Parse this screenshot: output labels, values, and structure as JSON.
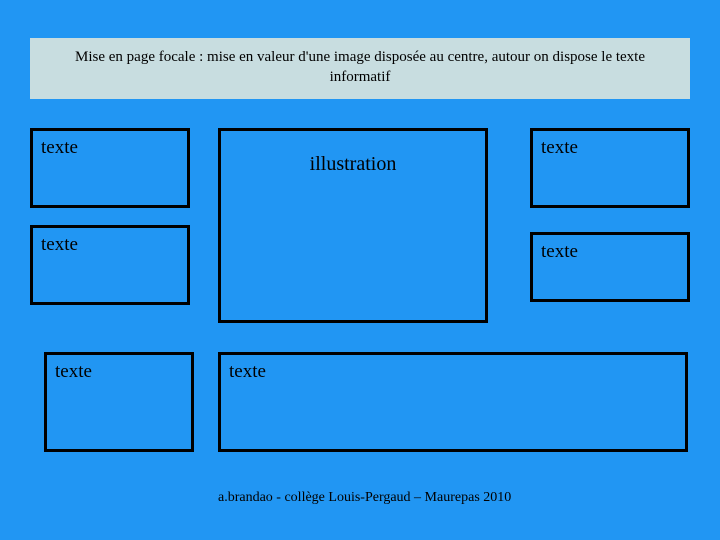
{
  "header": "Mise en page focale : mise en valeur d'une image disposée au centre, autour  on dispose le texte informatif",
  "boxes": {
    "tl": "texte",
    "ml": "texte",
    "bl": "texte",
    "center": "illustration",
    "tr": "texte",
    "mr": "texte",
    "bottom": "texte"
  },
  "footer": "a.brandao  - collège Louis-Pergaud – Maurepas 2010"
}
